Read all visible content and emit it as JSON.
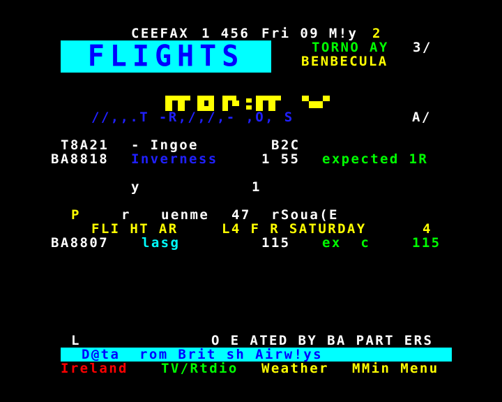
{
  "header": {
    "service": "CEEFAX",
    "page_number": "1 456",
    "datetime": "Fri 09 M!y",
    "subpage": "2"
  },
  "banner": {
    "title": "FLIGHTS"
  },
  "route": {
    "from": "TORNO AY",
    "page_of": "3/",
    "to": "BENBECULA"
  },
  "mosaic_text": "MONDAY",
  "columns_row": {
    "text": "//,,.T -R,/,/,- ,O, S",
    "right": "A/"
  },
  "flights_today": [
    {
      "number": "T8A21",
      "place": "- Ingoe",
      "time": "B2C",
      "status": ""
    },
    {
      "number": "BA8818",
      "place": "Inverness",
      "time": "1 55",
      "status": "expected 1R"
    }
  ],
  "misc_row": {
    "left": "y",
    "right": "1"
  },
  "notice_row": {
    "p": "P",
    "r": "r",
    "mid": "uenme",
    "num": "47",
    "tail": "rSoua(E"
  },
  "saturday_header": {
    "left": "FLI HT AR",
    "mid": "L4 F R SATURDAY",
    "right": "4"
  },
  "flights_saturday": [
    {
      "number": "BA8807",
      "place": "lasg",
      "time": "115",
      "status": "ex  c",
      "status_time": "115"
    }
  ],
  "footer": {
    "l": "L",
    "operated": "O E ATED BY BA PART ERS",
    "credit": "D@ta  rom Brit sh Airw!ys"
  },
  "fastext": {
    "red": "Ireland",
    "green": "TV/Rtdio",
    "yellow": "Weather",
    "cyan": "MMin Menu"
  },
  "colors": {
    "background": "#000000",
    "banner_bg": "#00ffff",
    "banner_fg": "#0000ff",
    "yellow": "#ffff00",
    "green": "#00ff00",
    "blue": "#2020ff",
    "red": "#ff0000",
    "cyan": "#00ffff",
    "white": "#ffffff"
  }
}
